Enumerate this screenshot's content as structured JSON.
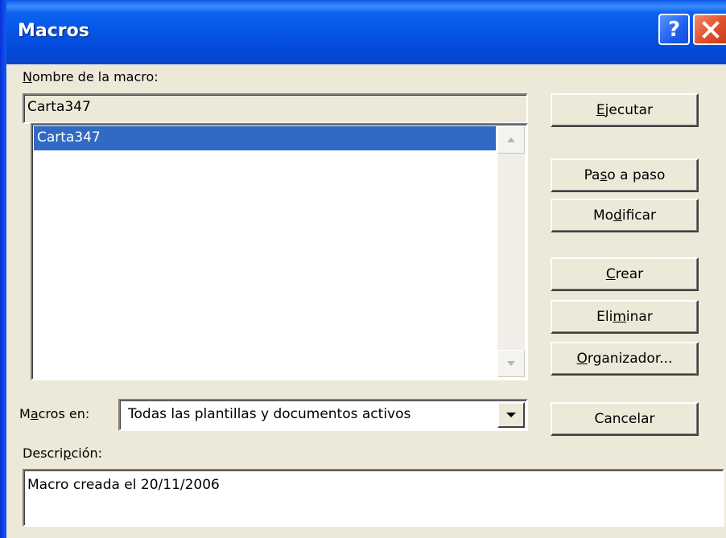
{
  "window": {
    "title": "Macros",
    "help_label": "?",
    "close_label": "✕"
  },
  "name_field": {
    "label_u": "N",
    "label_rest": "ombre de la macro:",
    "value": "Carta347"
  },
  "macro_list": {
    "items": [
      "Carta347"
    ],
    "selected": "Carta347"
  },
  "macros_in": {
    "label_pre": "M",
    "label_u": "a",
    "label_post": "cros en:",
    "value": "Todas las plantillas y documentos activos"
  },
  "description": {
    "label_pre": "Descri",
    "label_u": "p",
    "label_post": "ción:",
    "text": "Macro creada el 20/11/2006"
  },
  "buttons": {
    "run": {
      "pre": "",
      "u": "E",
      "post": "jecutar"
    },
    "step": {
      "pre": "Pa",
      "u": "s",
      "post": "o a paso"
    },
    "edit": {
      "pre": "Mo",
      "u": "d",
      "post": "ificar"
    },
    "create": {
      "pre": "",
      "u": "C",
      "post": "rear"
    },
    "delete": {
      "pre": "Eli",
      "u": "m",
      "post": "inar"
    },
    "organizer": {
      "pre": "",
      "u": "O",
      "post": "rganizador..."
    },
    "cancel": {
      "pre": "Cancelar",
      "u": "",
      "post": ""
    }
  },
  "colors": {
    "titlebar": "#0450e0",
    "selection": "#316ac5",
    "dialog_bg": "#ece9d8",
    "close_button": "#e0502c"
  },
  "icons": {
    "help": "question-icon",
    "close": "close-icon",
    "scroll_up": "triangle-up-icon",
    "scroll_down": "triangle-down-icon",
    "dropdown": "triangle-down-icon"
  }
}
